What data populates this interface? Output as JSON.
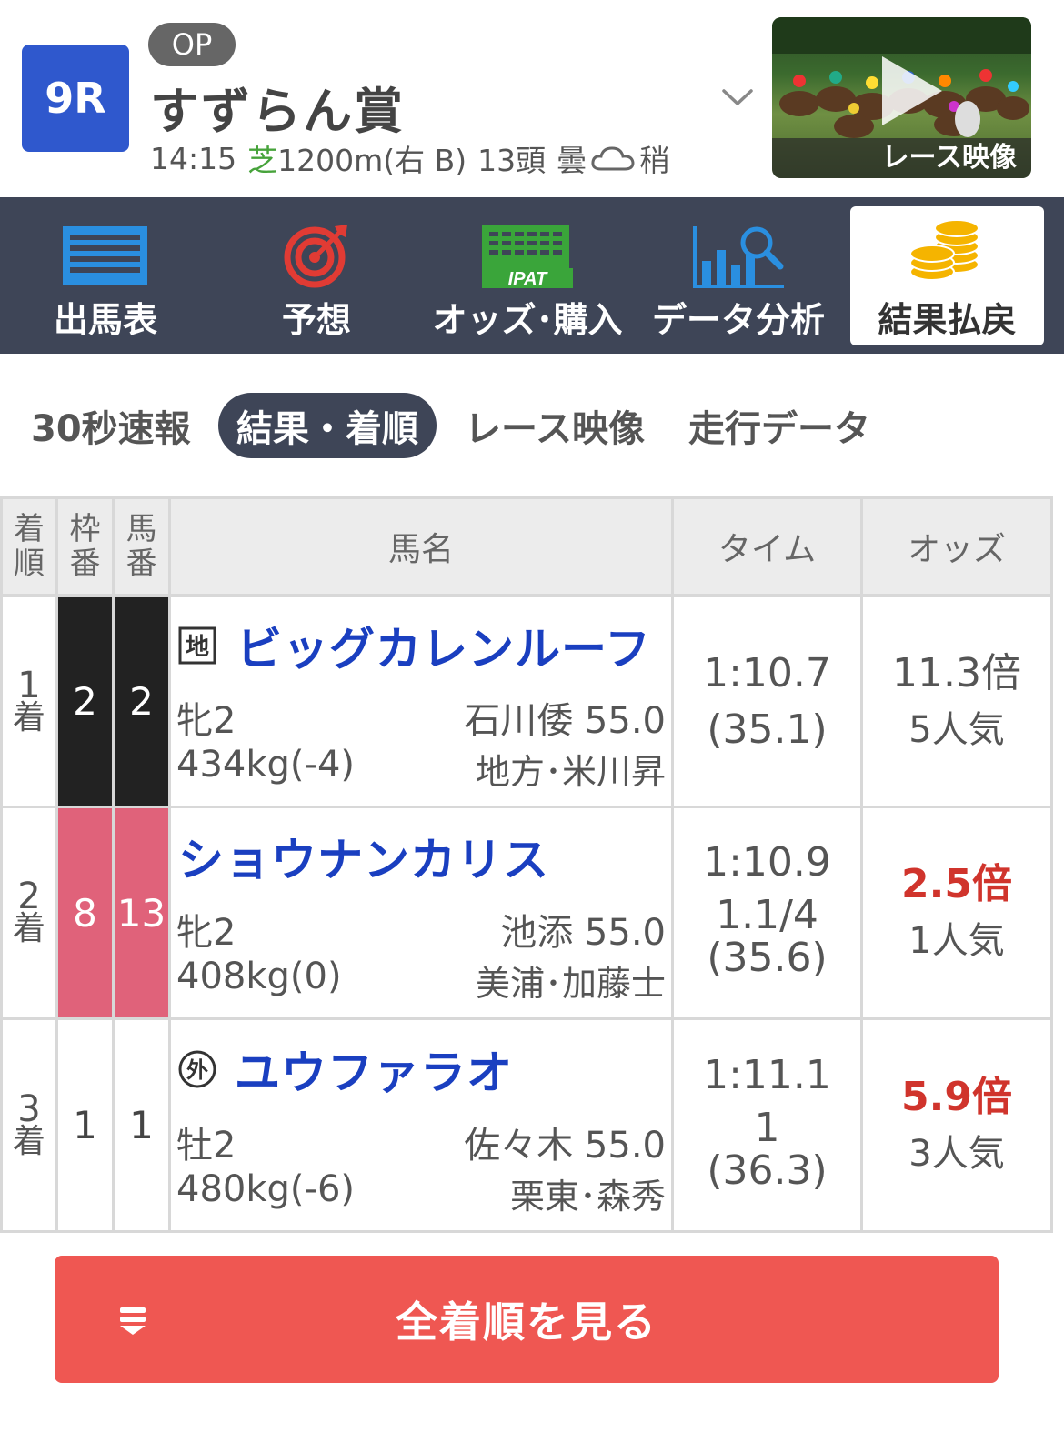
{
  "header": {
    "race_number": "9R",
    "grade": "OP",
    "title": "すずらん賞",
    "info": {
      "time": "14:15",
      "surface": "芝",
      "distance": "1200m(右 B)",
      "runners": "13頭",
      "weather": "曇",
      "going": "稍"
    },
    "video_caption": "レース映像"
  },
  "nav": {
    "items": [
      {
        "label": "出馬表",
        "icon": "race-card-icon"
      },
      {
        "label": "予想",
        "icon": "target-icon"
      },
      {
        "label": "オッズ･購入",
        "icon": "ipat-icon"
      },
      {
        "label": "データ分析",
        "icon": "chart-search-icon"
      },
      {
        "label": "結果払戻",
        "icon": "coins-icon",
        "active": true
      }
    ],
    "ipat_text": "IPAT"
  },
  "subtabs": [
    {
      "label": "30秒速報"
    },
    {
      "label": "結果・着順",
      "active": true
    },
    {
      "label": "レース映像"
    },
    {
      "label": "走行データ"
    }
  ],
  "table": {
    "headers": {
      "rank": [
        "着",
        "順"
      ],
      "frame": [
        "枠",
        "番"
      ],
      "number": [
        "馬",
        "番"
      ],
      "horse": "馬名",
      "time": "タイム",
      "odds": "オッズ"
    },
    "rows": [
      {
        "rank": "1",
        "rank_suffix": "着",
        "frame": "2",
        "number": "2",
        "tag": "地",
        "name": "ビッグカレンルーフ",
        "sex_age": "牝2",
        "weight": "434kg(-4)",
        "jockey": "石川倭 55.0",
        "trainer": "地方･米川昇",
        "time": "1:10.7",
        "margin": "",
        "last3f": "(35.1)",
        "odds": "11.3倍",
        "popularity": "5人気"
      },
      {
        "rank": "2",
        "rank_suffix": "着",
        "frame": "8",
        "number": "13",
        "tag": "",
        "name": "ショウナンカリス",
        "sex_age": "牝2",
        "weight": "408kg(0)",
        "jockey": "池添 55.0",
        "trainer": "美浦･加藤士",
        "time": "1:10.9",
        "margin": "1.1/4",
        "last3f": "(35.6)",
        "odds": "2.5倍",
        "popularity": "1人気"
      },
      {
        "rank": "3",
        "rank_suffix": "着",
        "frame": "1",
        "number": "1",
        "tag": "外",
        "name": "ユウファラオ",
        "sex_age": "牡2",
        "weight": "480kg(-6)",
        "jockey": "佐々木 55.0",
        "trainer": "栗東･森秀",
        "time": "1:11.1",
        "margin": "1",
        "last3f": "(36.3)",
        "odds": "5.9倍",
        "popularity": "3人気"
      }
    ]
  },
  "button": {
    "label": "全着順を見る"
  },
  "colors": {
    "race_badge": "#2f58cd",
    "nav_bg": "#3e4557",
    "horse_name": "#1a3fc0",
    "hot_odds": "#d0342c",
    "frame_1": "#ffffff",
    "frame_2": "#222222",
    "frame_8": "#e0627a",
    "button_bg": "#ef5752",
    "turf": "#47a33b"
  }
}
